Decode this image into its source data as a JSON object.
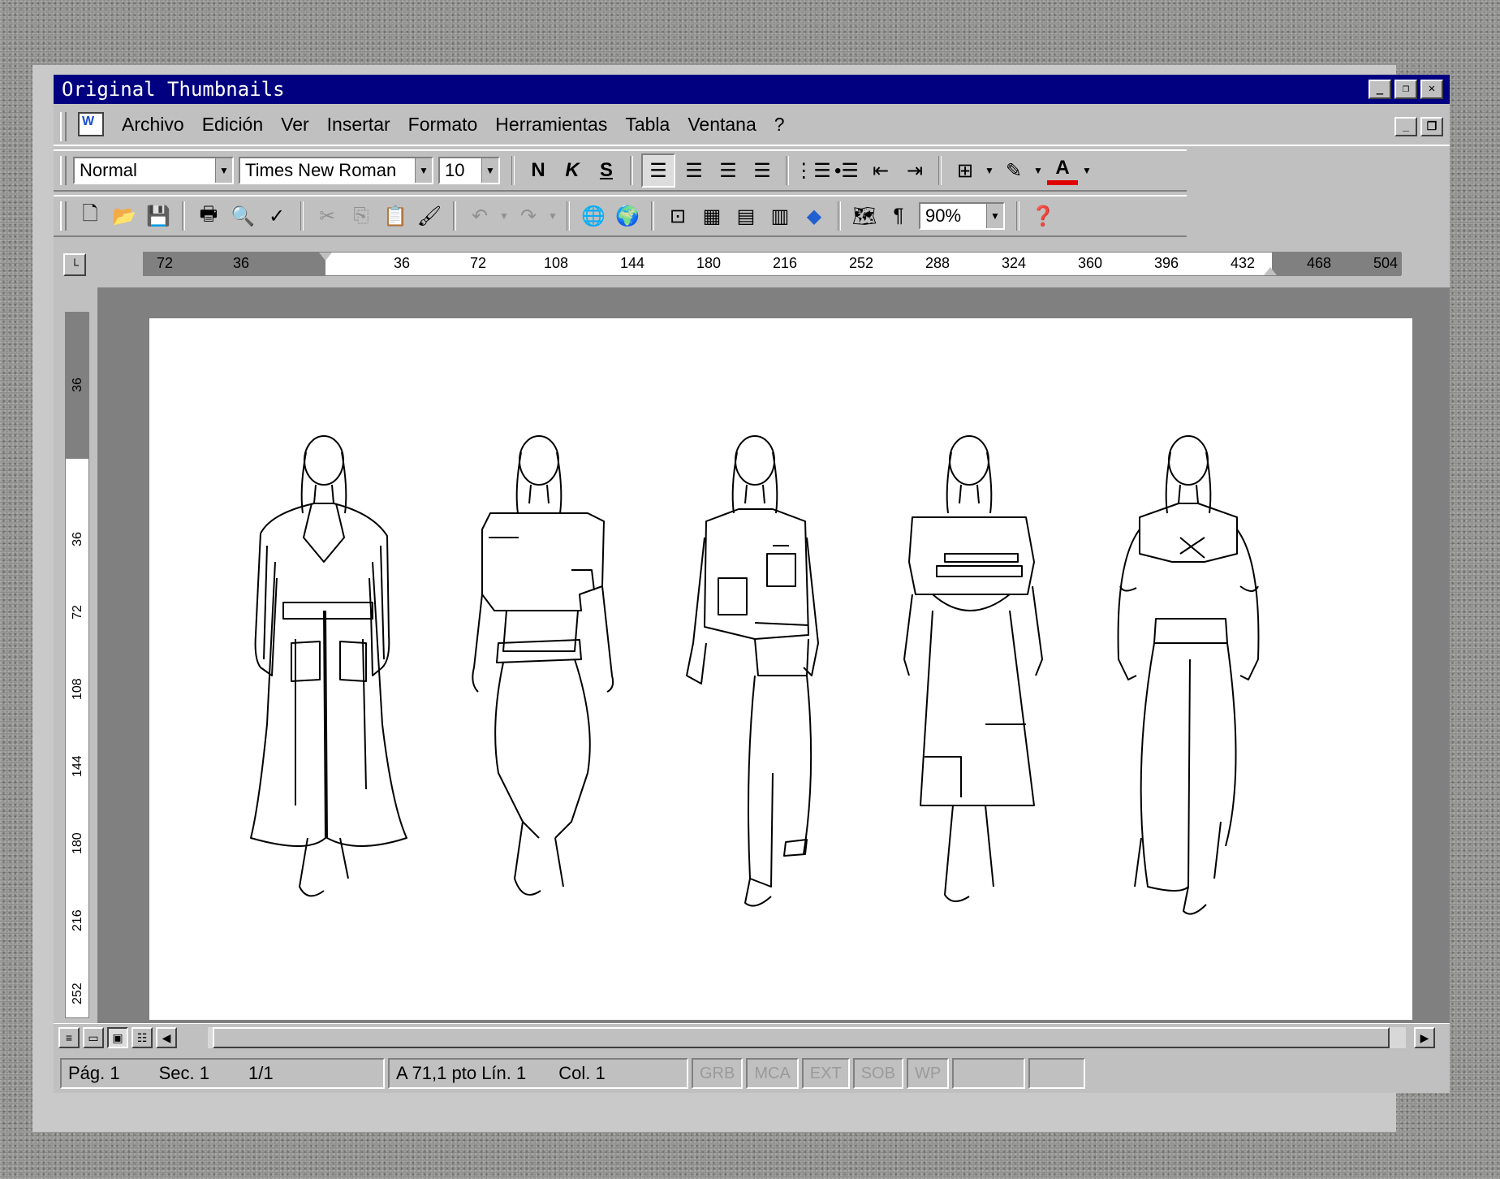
{
  "window": {
    "title": "Original Thumbnails"
  },
  "menu": {
    "items": [
      "Archivo",
      "Edición",
      "Ver",
      "Insertar",
      "Formato",
      "Herramientas",
      "Tabla",
      "Ventana",
      "?"
    ]
  },
  "format_toolbar": {
    "style": "Normal",
    "font": "Times New Roman",
    "size": "10",
    "bold": "N",
    "italic": "K",
    "underline": "S"
  },
  "standard_toolbar": {
    "zoom": "90%"
  },
  "ruler": {
    "labels": [
      "72",
      "36",
      "36",
      "72",
      "108",
      "144",
      "180",
      "216",
      "252",
      "288",
      "324",
      "360",
      "396",
      "432",
      "468",
      "504"
    ],
    "vertical_labels": [
      "36",
      "36",
      "72",
      "108",
      "144",
      "180",
      "216",
      "252"
    ]
  },
  "status": {
    "page": "Pág. 1",
    "section": "Sec. 1",
    "pages": "1/1",
    "position": "A 71,1 pto Lín. 1",
    "column": "Col. 1",
    "grb": "GRB",
    "mca": "MCA",
    "ext": "EXT",
    "sob": "SOB",
    "wp": "WP"
  },
  "document": {
    "figure_count": 5
  }
}
